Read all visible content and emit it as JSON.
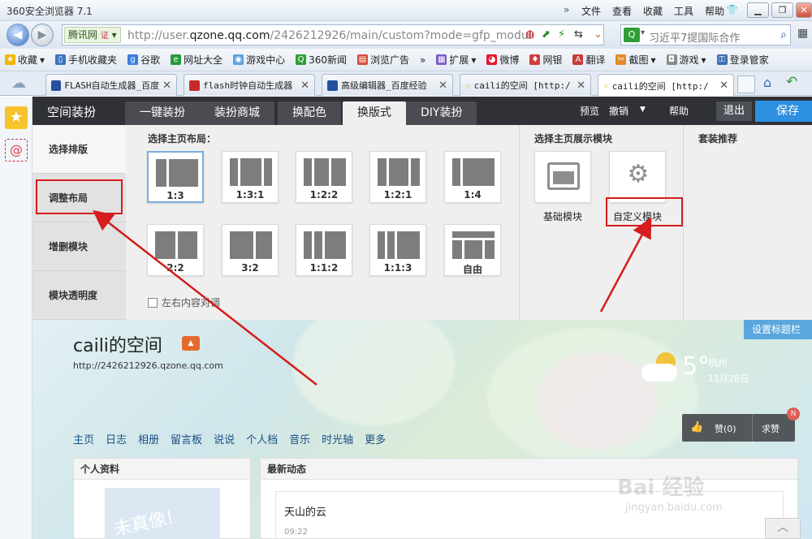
{
  "browser": {
    "title": "360安全浏览器 7.1",
    "menus": [
      "文件",
      "查看",
      "收藏",
      "工具",
      "帮助"
    ],
    "site_label": "腾讯网",
    "url_prefix": "http://user.",
    "url_host": "qzone.qq.com",
    "url_rest": "/2426212926/main/custom?mode=gfp_module&",
    "search_text": "习近平7提国际合作",
    "favorites": [
      "收藏",
      "手机收藏夹",
      "谷歌",
      "网址大全",
      "游戏中心",
      "360新闻",
      "浏览广告",
      "»",
      "扩展",
      "微博",
      "网银",
      "翻译",
      "截图",
      "游戏",
      "登录管家"
    ],
    "tabs": [
      "FLASH自动生成器_百度",
      "flash时钟自动生成器",
      "高级编辑器_百度经验",
      "caili的空间 [http:/",
      "caili的空间 [http:/"
    ]
  },
  "editor": {
    "title": "空间装扮",
    "tabs": [
      "一键装扮",
      "装扮商城",
      "换配色",
      "换版式",
      "DIY装扮"
    ],
    "active_tab": 3,
    "preview": "预览",
    "undo": "撤销",
    "help": "帮助",
    "exit": "退出",
    "save": "保存",
    "side": [
      "选择排版",
      "调整布局",
      "增删模块",
      "模块透明度"
    ],
    "layout_title": "选择主页布局：",
    "layouts": [
      "1:3",
      "1:3:1",
      "1:2:2",
      "1:2:1",
      "1:4",
      "2:2",
      "3:2",
      "1:1:2",
      "1:1:3",
      "自由"
    ],
    "modules_title": "选择主页展示模块",
    "modules": [
      "基础模块",
      "自定义模块"
    ],
    "suit_title": "套装推荐",
    "swap_label": "左右内容对调"
  },
  "qzone": {
    "name": "caili的空间",
    "url": "http://2426212926.qzone.qq.com",
    "config": "设置标题栏",
    "weather_temp": "5°",
    "weather_city": "杭州",
    "weather_date": "11月28日",
    "nav": [
      "主页",
      "日志",
      "相册",
      "留言板",
      "说说",
      "个人档",
      "音乐",
      "时光轴",
      "更多"
    ],
    "like": "赞(0)",
    "ask": "求赞",
    "badge": "N",
    "profile": "个人资料",
    "feed": "最新动态",
    "feed_item": "天山的云",
    "feed_time": "09:22",
    "avatar_text": "未真像!"
  },
  "watermark": {
    "brand": "Bai 经验",
    "url": "jingyan.baidu.com"
  }
}
